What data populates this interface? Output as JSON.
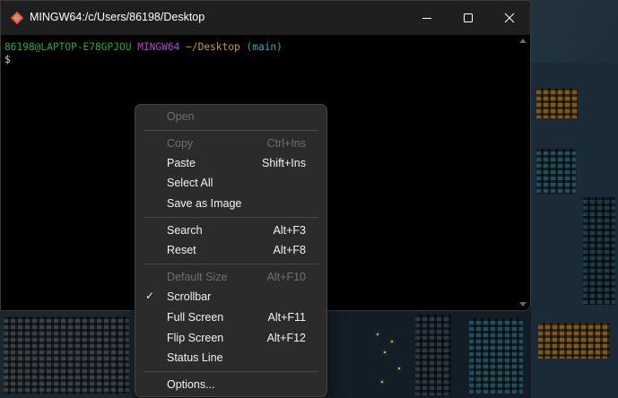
{
  "window": {
    "title": "MINGW64:/c/Users/86198/Desktop"
  },
  "terminal": {
    "user_host": "86198@LAPTOP-E78GPJOU",
    "system": "MINGW64",
    "path": "~/Desktop",
    "branch": "(main)",
    "prompt_symbol": "$"
  },
  "menu": {
    "items": [
      {
        "label": "Open",
        "shortcut": "",
        "disabled": true,
        "checked": false
      },
      {
        "label": "Copy",
        "shortcut": "Ctrl+Ins",
        "disabled": true,
        "checked": false
      },
      {
        "label": "Paste",
        "shortcut": "Shift+Ins",
        "disabled": false,
        "checked": false
      },
      {
        "label": "Select All",
        "shortcut": "",
        "disabled": false,
        "checked": false
      },
      {
        "label": "Save as Image",
        "shortcut": "",
        "disabled": false,
        "checked": false
      },
      {
        "label": "Search",
        "shortcut": "Alt+F3",
        "disabled": false,
        "checked": false
      },
      {
        "label": "Reset",
        "shortcut": "Alt+F8",
        "disabled": false,
        "checked": false
      },
      {
        "label": "Default Size",
        "shortcut": "Alt+F10",
        "disabled": true,
        "checked": false
      },
      {
        "label": "Scrollbar",
        "shortcut": "",
        "disabled": false,
        "checked": true
      },
      {
        "label": "Full Screen",
        "shortcut": "Alt+F11",
        "disabled": false,
        "checked": false
      },
      {
        "label": "Flip Screen",
        "shortcut": "Alt+F12",
        "disabled": false,
        "checked": false
      },
      {
        "label": "Status Line",
        "shortcut": "",
        "disabled": false,
        "checked": false
      },
      {
        "label": "Options...",
        "shortcut": "",
        "disabled": false,
        "checked": false
      }
    ],
    "check_glyph": "✓"
  },
  "colors": {
    "prompt_user": "#2ea53a",
    "prompt_system": "#b348c6",
    "prompt_path": "#c0a22a",
    "prompt_branch": "#2aa9b7",
    "menu_background": "#2b2b2b",
    "titlebar": "#1f1f1f"
  },
  "icons": {
    "app": "git-bash-icon",
    "minimize": "minimize-icon",
    "maximize": "maximize-icon",
    "close": "close-icon"
  }
}
